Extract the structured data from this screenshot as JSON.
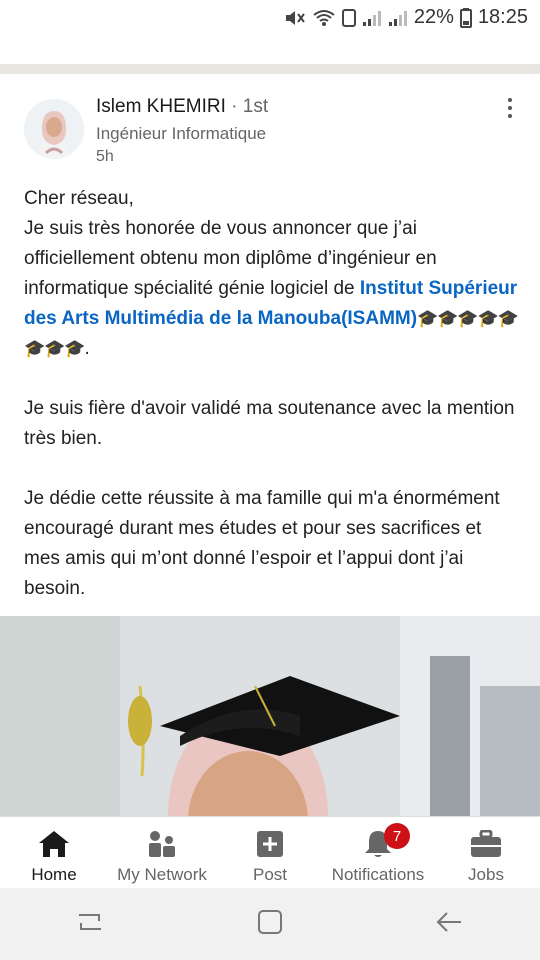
{
  "status_bar": {
    "battery_percent": "22%",
    "time": "18:25",
    "icons": [
      "mute-icon",
      "wifi-icon",
      "signal-icon",
      "signal-icon",
      "battery-icon"
    ]
  },
  "post": {
    "author": "Islem KHEMIRI",
    "degree": "· 1st",
    "headline": "Ingénieur Informatique",
    "time": "5h",
    "greeting": "Cher réseau,",
    "para1_prefix": "Je suis très honorée de vous annoncer que j’ai officiellement obtenu mon diplôme d’ingénieur en informatique spécialité  génie logiciel de ",
    "para1_link": "Institut Supérieur des Arts Multimédia de la Manouba(ISAMM)",
    "para1_emojis": "🎓🎓🎓🎓🎓🎓🎓🎓",
    "para1_suffix": ".",
    "para2": "Je suis fière d'avoir validé ma soutenance avec la mention très bien.",
    "para3": "Je dédie cette réussite à ma famille qui m'a énormément encouragé durant mes études et pour ses sacrifices et mes amis qui m’ont donné l’espoir et l’appui dont j’ai besoin."
  },
  "bottom_nav": {
    "items": [
      {
        "label": "Home",
        "icon": "home-icon",
        "active": true
      },
      {
        "label": "My Network",
        "icon": "network-icon",
        "active": false
      },
      {
        "label": "Post",
        "icon": "post-icon",
        "active": false
      },
      {
        "label": "Notifications",
        "icon": "bell-icon",
        "active": false,
        "badge": "7"
      },
      {
        "label": "Jobs",
        "icon": "briefcase-icon",
        "active": false
      }
    ]
  },
  "colors": {
    "link": "#0a66c2",
    "badge": "#cc1016",
    "separator": "#e8e6e0"
  }
}
